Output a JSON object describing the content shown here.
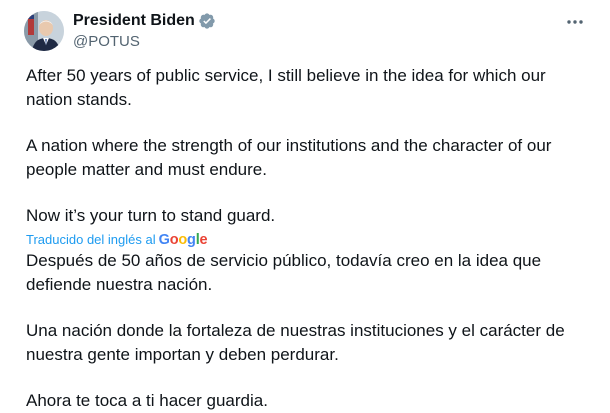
{
  "author": {
    "display_name": "President Biden",
    "handle": "@POTUS",
    "verified": true
  },
  "icons": {
    "avatar": "avatar-photo",
    "verified": "verified-badge-icon",
    "more": "more-options-icon"
  },
  "colors": {
    "link_blue": "#1d9bf0",
    "text_primary": "#0f1419",
    "text_secondary": "#536471",
    "google_blue": "#4285f4",
    "google_red": "#ea4335",
    "google_yellow": "#fbbc05",
    "google_green": "#34a853"
  },
  "tweet": {
    "original": [
      "After 50 years of public service, I still believe in the idea for which our\nnation stands.",
      "A nation where the strength of our institutions and the character of our\npeople matter and must endure.",
      "Now it’s your turn to stand guard."
    ],
    "translation_label": "Traducido del inglés al",
    "translation_provider": {
      "g1": "G",
      "o1": "o",
      "o2": "o",
      "g2": "g",
      "l": "l",
      "e": "e"
    },
    "translated": [
      "Después de 50 años de servicio público, todavía creo en la idea que\ndefiende nuestra nación.",
      "Una nación donde la fortaleza de nuestras instituciones y el carácter de\nnuestra gente importan y deben perdurar.",
      "Ahora te toca a ti hacer guardia."
    ]
  }
}
